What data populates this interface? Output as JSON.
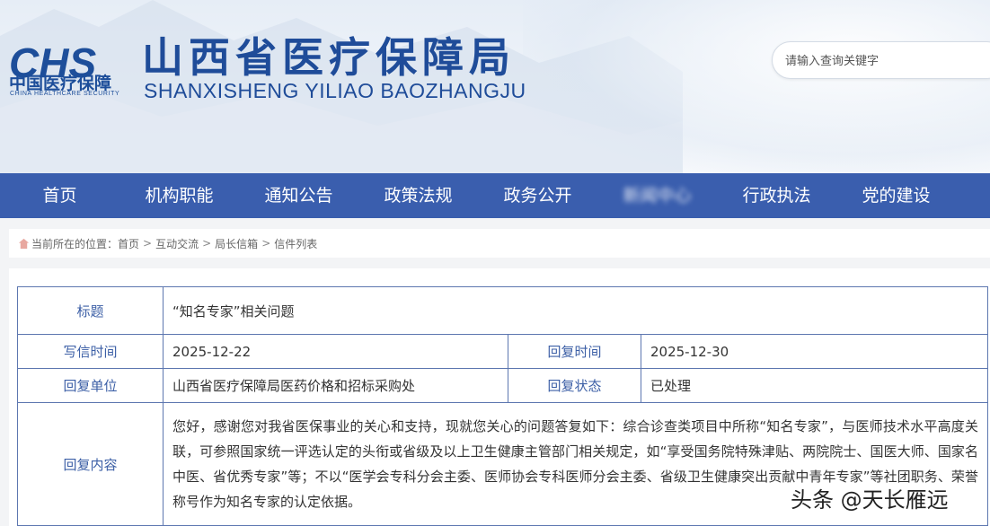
{
  "header": {
    "logo_mark": "CHS",
    "logo_cn": "中国医疗保障",
    "logo_en": "CHINA HEALTHCARE SECURITY",
    "site_title": "山西省医疗保障局",
    "site_subtitle": "SHANXISHENG YILIAO BAOZHANGJU",
    "search_placeholder": "请输入查询关键字"
  },
  "nav": {
    "items": [
      "首页",
      "机构职能",
      "通知公告",
      "政策法规",
      "政务公开",
      "新闻中心",
      "行政执法",
      "党的建设"
    ]
  },
  "breadcrumb": {
    "prefix": "当前所在的位置：",
    "items": [
      "首页",
      "互动交流",
      "局长信箱",
      "信件列表"
    ],
    "sep": ">"
  },
  "letter": {
    "title_label": "标题",
    "title_value": "“知名专家”相关问题",
    "write_time_label": "写信时间",
    "write_time_value": "2025-12-22",
    "reply_time_label": "回复时间",
    "reply_time_value": "2025-12-30",
    "reply_unit_label": "回复单位",
    "reply_unit_value": "山西省医疗保障局医药价格和招标采购处",
    "reply_status_label": "回复状态",
    "reply_status_value": "已处理",
    "reply_content_label": "回复内容",
    "reply_content_value": "您好，感谢您对我省医保事业的关心和支持，现就您关心的问题答复如下：综合诊查类项目中所称“知名专家”，与医师技术水平高度关联，可参照国家统一评选认定的头衔或省级及以上卫生健康主管部门相关规定，如“享受国务院特殊津贴、两院院士、国医大师、国家名中医、省优秀专家”等；不以“医学会专科分会主委、医师协会专科医师分会主委、省级卫生健康突出贡献中青年专家”等社团职务、荣誉称号作为知名专家的认定依据。"
  },
  "watermark": "头条 @天长雁远",
  "colors": {
    "nav_bg": "#3a5eae",
    "brand_blue": "#1f4c99",
    "label_blue": "#3c5fa6",
    "table_border": "#5d77b0"
  }
}
